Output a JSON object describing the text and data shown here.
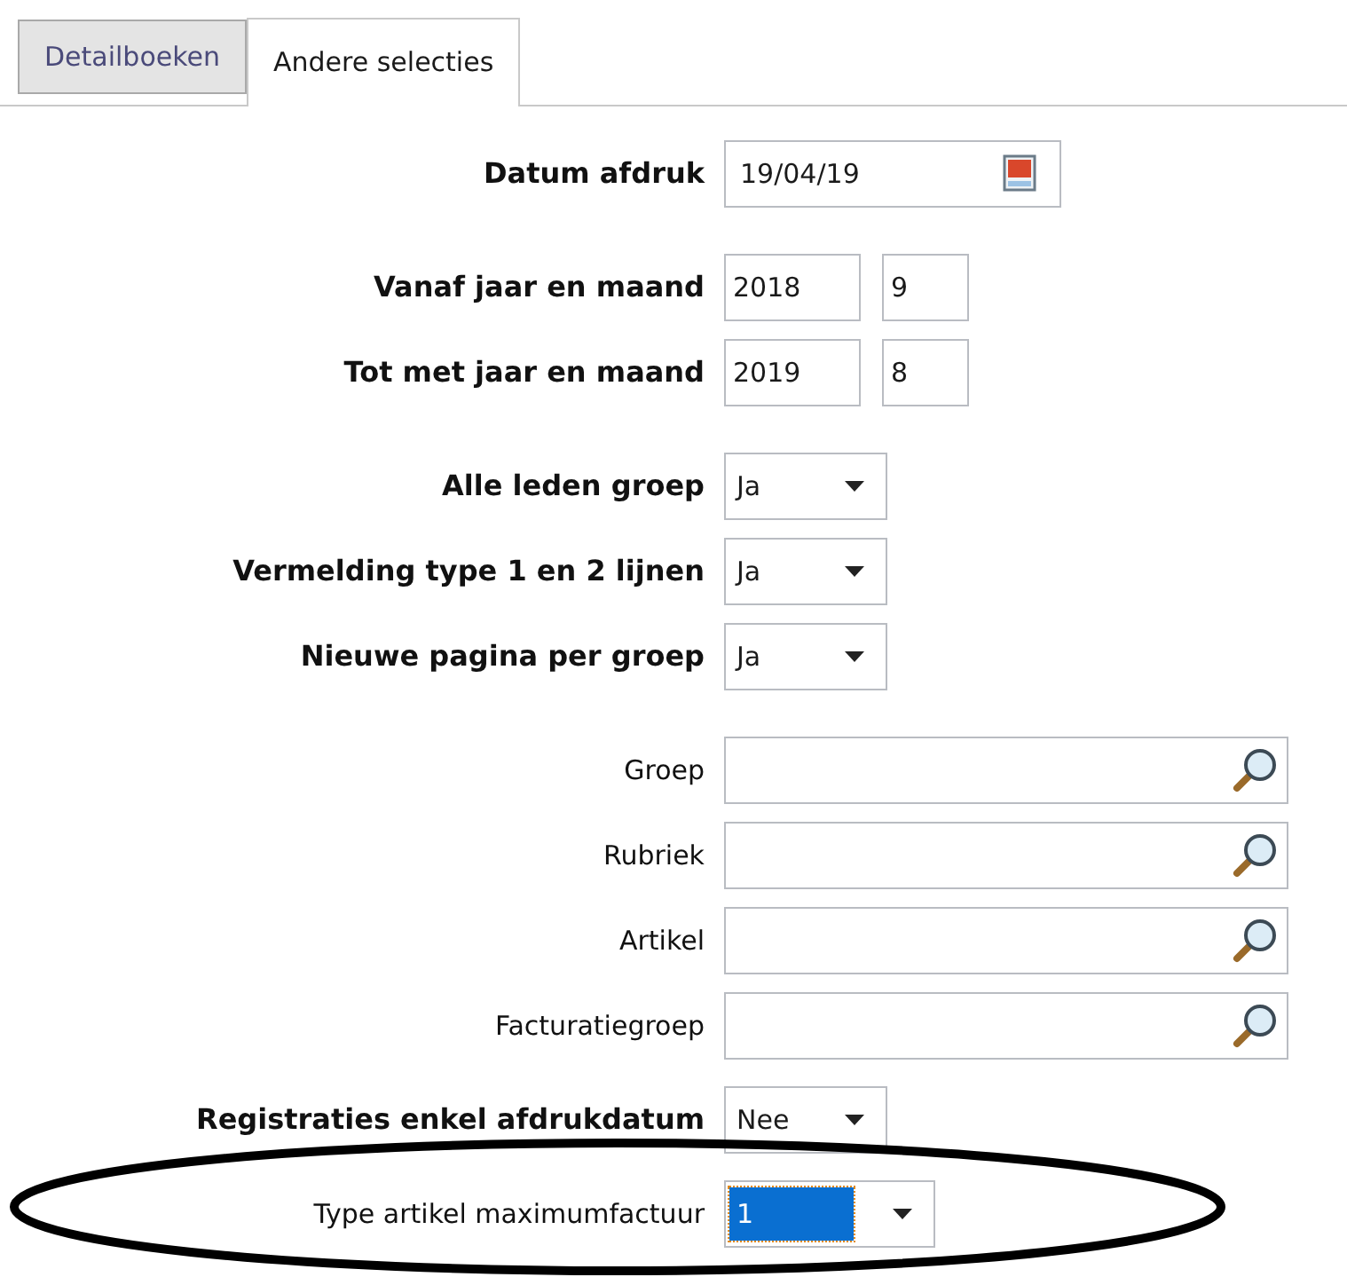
{
  "tabs": [
    {
      "label": "Detailboeken",
      "selected": false
    },
    {
      "label": "Andere selecties",
      "selected": true
    }
  ],
  "sections": [
    {
      "rows": [
        {
          "kind": "date",
          "label": "Datum afdruk",
          "bold": true,
          "value": "19/04/19"
        }
      ]
    },
    {
      "rows": [
        {
          "kind": "pair",
          "label": "Vanaf jaar en maand",
          "bold": true,
          "value": "2018",
          "value_2": "9"
        },
        {
          "kind": "pair",
          "label": "Tot met jaar en maand",
          "bold": true,
          "value": "2019",
          "value_2": "8"
        }
      ]
    },
    {
      "rows": [
        {
          "kind": "select",
          "label": "Alle leden groep",
          "bold": true,
          "value": "Ja",
          "selected": false
        },
        {
          "kind": "select",
          "label": "Vermelding type 1 en 2 lijnen",
          "bold": true,
          "value": "Ja",
          "selected": false
        },
        {
          "kind": "select",
          "label": "Nieuwe pagina per groep",
          "bold": true,
          "value": "Ja",
          "selected": false
        }
      ]
    },
    {
      "rows": [
        {
          "kind": "lookup",
          "label": "Groep",
          "bold": false
        },
        {
          "kind": "lookup",
          "label": "Rubriek",
          "bold": false
        },
        {
          "kind": "lookup",
          "label": "Artikel",
          "bold": false
        },
        {
          "kind": "lookup",
          "label": "Facturatiegroep",
          "bold": false
        }
      ]
    },
    {
      "rows": [
        {
          "kind": "select",
          "label": "Registraties enkel afdrukdatum",
          "bold": true,
          "value": "Nee",
          "selected": false
        },
        {
          "kind": "select",
          "label": "Type artikel maximumfactuur",
          "bold": false,
          "value": "1",
          "selected": true,
          "wide": true
        }
      ]
    }
  ]
}
